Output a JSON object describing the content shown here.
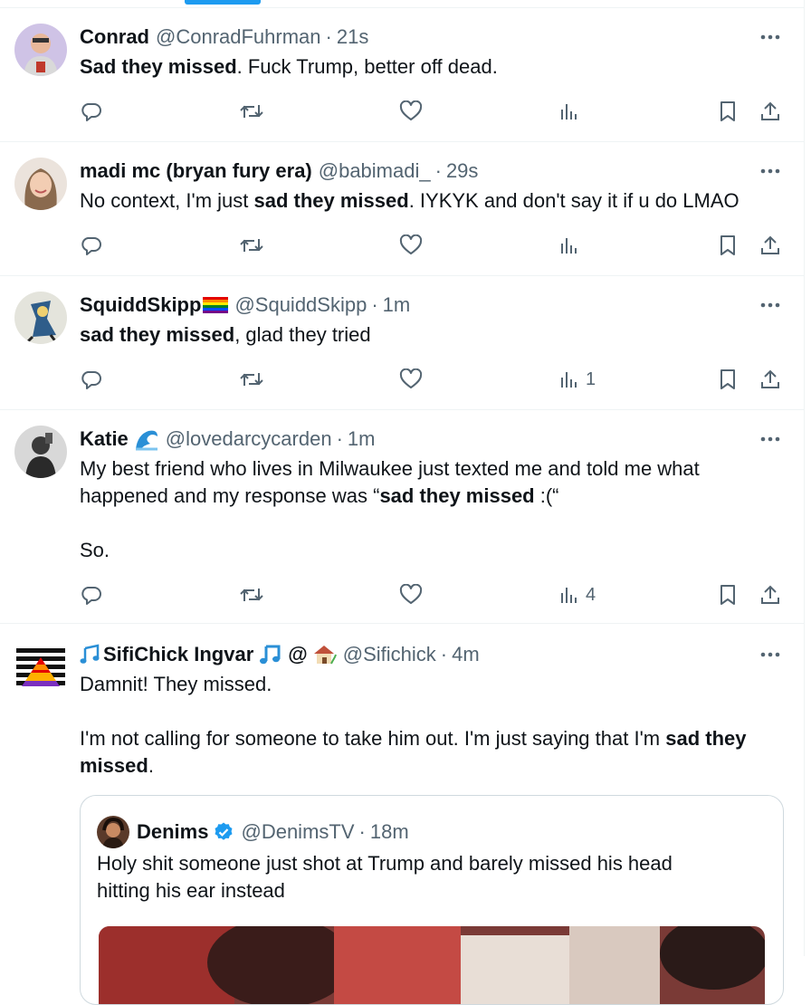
{
  "colors": {
    "text": "#0f1419",
    "muted": "#536471",
    "accent": "#1d9bf0",
    "divider": "#eff3f4"
  },
  "tweets": [
    {
      "name": "Conrad",
      "handle": "@ConradFuhrman",
      "dot": "·",
      "time": "21s",
      "body": {
        "b1": "Sad they missed",
        "t1": ". Fuck Trump, better off dead."
      },
      "views": ""
    },
    {
      "name": "madi mc (bryan fury era)",
      "handle": "@babimadi_",
      "dot": "·",
      "time": "29s",
      "body": {
        "t1": "No context, I'm just ",
        "b1": "sad they missed",
        "t2": ". IYKYK and don't say it if u do LMAO"
      },
      "views": ""
    },
    {
      "name": "SquiddSkipp",
      "name_emoji": "🏳️‍🌈",
      "handle": "@SquiddSkipp",
      "dot": "·",
      "time": "1m",
      "body": {
        "b1": "sad they missed",
        "t1": ", glad they tried"
      },
      "views": "1"
    },
    {
      "name": "Katie",
      "name_emoji": "🌊",
      "handle": "@lovedarcycarden",
      "dot": "·",
      "time": "1m",
      "body": {
        "t1": "My best friend who lives in Milwaukee just texted me and told me what happened and my response was “",
        "b1": "sad they missed",
        "t2": " :(“",
        "t3": "So."
      },
      "views": "4"
    },
    {
      "name_prefix_emoji": "🎶",
      "name": "SifiChick Ingvar",
      "name_suffix": "🎵 @ 🏡",
      "handle": "@Sifichick",
      "dot": "·",
      "time": "4m",
      "body": {
        "t1": "Damnit! They missed.",
        "t2": "I'm not calling for someone to take him out. I'm just saying that I'm ",
        "b1": "sad they missed",
        "t3": "."
      },
      "quote": {
        "name": "Denims",
        "handle": "@DenimsTV",
        "dot": "·",
        "time": "18m",
        "text": "Holy shit someone just shot at Trump and barely missed his head hitting his ear instead"
      }
    }
  ],
  "icons": [
    "reply-icon",
    "retweet-icon",
    "like-icon",
    "views-icon",
    "bookmark-icon",
    "share-icon",
    "more-icon",
    "verified-icon"
  ]
}
